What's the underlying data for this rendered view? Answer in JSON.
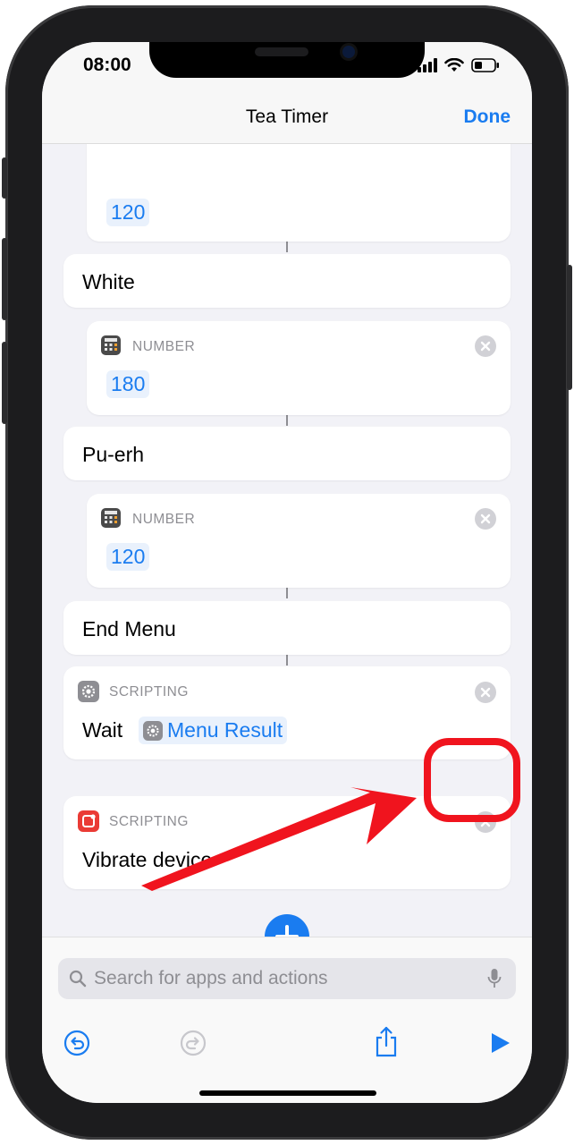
{
  "status": {
    "time": "08:00"
  },
  "nav": {
    "title": "Tea Timer",
    "done": "Done"
  },
  "actions": [
    {
      "kind": "number-partial",
      "value": "120"
    },
    {
      "kind": "menu-item",
      "label": "White"
    },
    {
      "kind": "number",
      "category": "NUMBER",
      "value": "180"
    },
    {
      "kind": "menu-item",
      "label": "Pu-erh"
    },
    {
      "kind": "number",
      "category": "NUMBER",
      "value": "120"
    },
    {
      "kind": "menu-end",
      "label": "End Menu"
    },
    {
      "kind": "wait",
      "category": "SCRIPTING",
      "label": "Wait",
      "variable": "Menu Result"
    },
    {
      "kind": "vibrate",
      "category": "SCRIPTING",
      "label": "Vibrate device"
    }
  ],
  "toolbar": {
    "search_placeholder": "Search for apps and actions"
  },
  "annotation": {
    "color": "#f0141e",
    "target": "remove-action-button"
  },
  "colors": {
    "accent": "#1a7cf0",
    "background": "#f2f2f7"
  }
}
